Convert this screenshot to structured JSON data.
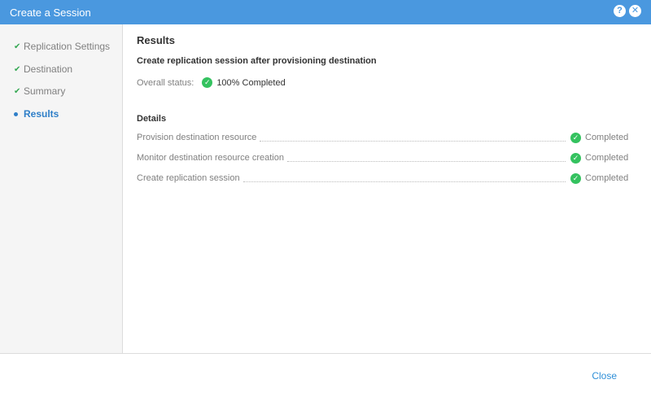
{
  "window": {
    "title": "Create a Session",
    "help_icon": "help-icon",
    "close_icon": "close-icon"
  },
  "sidebar": {
    "steps": [
      {
        "label": "Replication Settings",
        "state": "done"
      },
      {
        "label": "Destination",
        "state": "done"
      },
      {
        "label": "Summary",
        "state": "done"
      },
      {
        "label": "Results",
        "state": "active"
      }
    ]
  },
  "main": {
    "heading": "Results",
    "subtitle": "Create replication session after provisioning destination",
    "overall_label": "Overall status:",
    "overall_value": "100% Completed",
    "details_heading": "Details",
    "details": [
      {
        "name": "Provision destination resource",
        "status": "Completed"
      },
      {
        "name": "Monitor destination resource creation",
        "status": "Completed"
      },
      {
        "name": "Create replication session",
        "status": "Completed"
      }
    ]
  },
  "footer": {
    "close_label": "Close"
  },
  "colors": {
    "titlebar": "#4a98df",
    "accent": "#2f7fc8",
    "success": "#34c25f",
    "sidebar_bg": "#f5f5f5"
  }
}
